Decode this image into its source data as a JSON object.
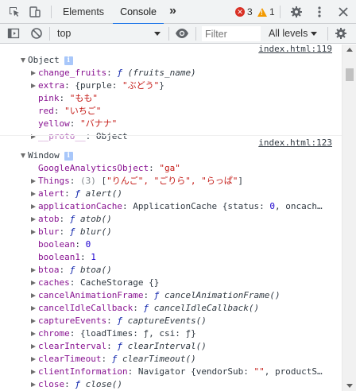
{
  "tabbar": {
    "tabs": [
      {
        "label": "Elements",
        "active": false
      },
      {
        "label": "Console",
        "active": true
      }
    ],
    "more_tabs": "»",
    "error_count": "3",
    "warning_count": "1"
  },
  "toolbar": {
    "context": "top",
    "filter_placeholder": "Filter",
    "levels_label": "All levels"
  },
  "messages": [
    {
      "source": "index.html:119",
      "header": "Object",
      "rows": [
        {
          "expand": "right",
          "key": "change_fruits",
          "colon": ": ",
          "f": "ƒ",
          "sig": " (fruits_name)"
        },
        {
          "expand": "right",
          "key": "extra",
          "colon": ": ",
          "pre": "{purple: ",
          "str": "\"ぶどう\"",
          "post": "}"
        },
        {
          "expand": "none",
          "key": "pink",
          "colon": ": ",
          "str": "\"もも\""
        },
        {
          "expand": "none",
          "key": "red",
          "colon": ": ",
          "str": "\"いちご\""
        },
        {
          "expand": "none",
          "key": "yellow",
          "colon": ": ",
          "str": "\"バナナ\""
        },
        {
          "expand": "right",
          "key": "__proto__",
          "colon": ": ",
          "obj": "Object",
          "proto": true
        }
      ]
    },
    {
      "source": "index.html:123",
      "header": "Window",
      "rows": [
        {
          "expand": "none",
          "key": "GoogleAnalyticsObject",
          "colon": ": ",
          "str": "\"ga\""
        },
        {
          "expand": "right",
          "key": "Things",
          "colon": ": ",
          "gray": "(3) ",
          "pre": "[",
          "str": "\"りんご\", \"ごりら\", \"らっぱ\"",
          "post": "]"
        },
        {
          "expand": "right",
          "key": "alert",
          "colon": ": ",
          "f": "ƒ",
          "sig": " alert()"
        },
        {
          "expand": "right",
          "key": "applicationCache",
          "colon": ": ",
          "obj": "ApplicationCache {status: ",
          "num": "0",
          "post": ", oncach…"
        },
        {
          "expand": "right",
          "key": "atob",
          "colon": ": ",
          "f": "ƒ",
          "sig": " atob()"
        },
        {
          "expand": "right",
          "key": "blur",
          "colon": ": ",
          "f": "ƒ",
          "sig": " blur()"
        },
        {
          "expand": "none",
          "key": "boolean",
          "colon": ": ",
          "num": "0"
        },
        {
          "expand": "none",
          "key": "boolean1",
          "colon": ": ",
          "num": "1"
        },
        {
          "expand": "right",
          "key": "btoa",
          "colon": ": ",
          "f": "ƒ",
          "sig": " btoa()"
        },
        {
          "expand": "right",
          "key": "caches",
          "colon": ": ",
          "obj": "CacheStorage {}"
        },
        {
          "expand": "right",
          "key": "cancelAnimationFrame",
          "colon": ": ",
          "f": "ƒ",
          "sig": " cancelAnimationFrame()"
        },
        {
          "expand": "right",
          "key": "cancelIdleCallback",
          "colon": ": ",
          "f": "ƒ",
          "sig": " cancelIdleCallback()"
        },
        {
          "expand": "right",
          "key": "captureEvents",
          "colon": ": ",
          "f": "ƒ",
          "sig": " captureEvents()"
        },
        {
          "expand": "right",
          "key": "chrome",
          "colon": ": ",
          "obj": "{loadTimes: ƒ, csi: ƒ}"
        },
        {
          "expand": "right",
          "key": "clearInterval",
          "colon": ": ",
          "f": "ƒ",
          "sig": " clearInterval()"
        },
        {
          "expand": "right",
          "key": "clearTimeout",
          "colon": ": ",
          "f": "ƒ",
          "sig": " clearTimeout()"
        },
        {
          "expand": "right",
          "key": "clientInformation",
          "colon": ": ",
          "obj": "Navigator {vendorSub: ",
          "str": "\"\"",
          "post": ", productS…"
        },
        {
          "expand": "right",
          "key": "close",
          "colon": ": ",
          "f": "ƒ",
          "sig": " close()"
        }
      ]
    }
  ]
}
